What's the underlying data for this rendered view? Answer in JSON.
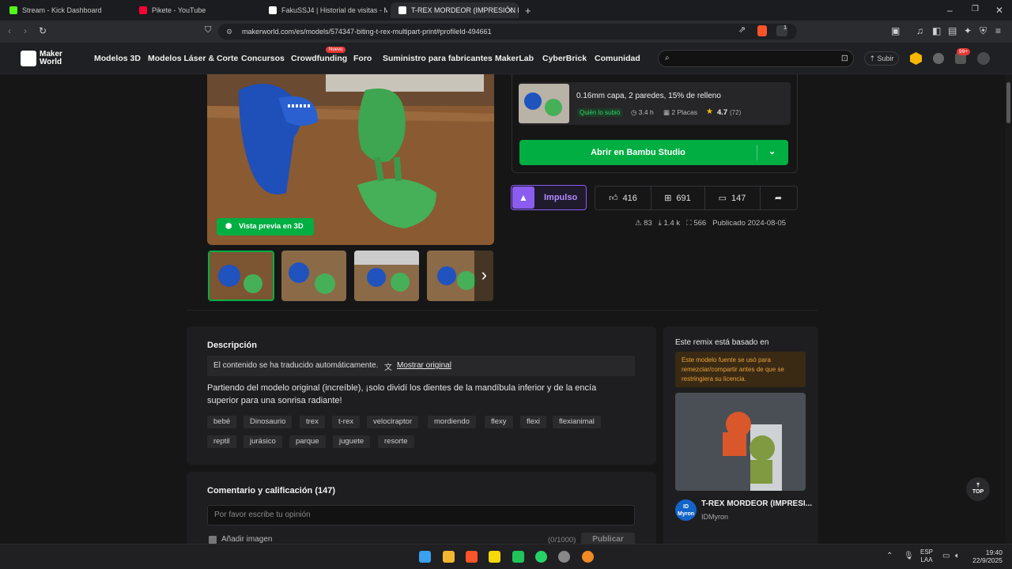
{
  "browser": {
    "tabs": [
      {
        "label": "Stream - Kick Dashboard",
        "color": "#53fc18"
      },
      {
        "label": "Pikete - YouTube",
        "color": "#ff0033"
      },
      {
        "label": "FakuSSJ4 | Historial de visitas - Make",
        "color": "#ffffff"
      },
      {
        "label": "T-REX MORDEOR (IMPRESIÓN E",
        "color": "#ffffff"
      }
    ],
    "url": "makerworld.com/es/models/574347-biting-t-rex-multipart-print#profileId-494661",
    "shield_badge": "1"
  },
  "site": {
    "logo_line1": "Maker",
    "logo_line2": "World",
    "nav": [
      "Modelos 3D",
      "Modelos Láser & Corte",
      "Concursos",
      "Crowdfunding",
      "Foro",
      "Suministro para fabricantes",
      "MakerLab",
      "CyberBrick",
      "Comunidad"
    ],
    "new_badge": "Nuevo",
    "upload_label": "Subir",
    "notif_badge": "99+"
  },
  "gallery": {
    "preview_3d": "Vista previa en 3D"
  },
  "profile": {
    "settings": "0.16mm capa, 2 paredes, 15% de relleno",
    "uploader_badge": "Quién lo subió",
    "time": "3.4 h",
    "plates": "2 Placas",
    "rating": "4.7",
    "rating_count": "(72)",
    "open_button": "Abrir en Bambu Studio"
  },
  "actions": {
    "boost_label": "Impulso",
    "likes": "416",
    "collects": "691",
    "comments": "147"
  },
  "meta": {
    "prints": "83",
    "downloads": "1.4 k",
    "makes": "566",
    "published": "Publicado 2024-08-05"
  },
  "description": {
    "heading": "Descripción",
    "translated_note": "El contenido se ha traducido automáticamente.",
    "show_original": "Mostrar original",
    "text": "Partiendo del modelo original (increíble), ¡solo dividí los dientes de la mandíbula inferior y de la encía superior para una sonrisa radiante!",
    "tags": [
      "bebé",
      "Dinosaurio",
      "trex",
      "t-rex",
      "velociraptor",
      "mordiendo",
      "flexy",
      "flexi",
      "flexianimal",
      "reptil",
      "jurásico",
      "parque",
      "juguete",
      "resorte"
    ]
  },
  "comments": {
    "heading": "Comentario y calificación (147)",
    "placeholder": "Por favor escribe tu opinión",
    "add_image": "Añadir imagen",
    "counter": "(0/1000)",
    "publish": "Publicar"
  },
  "remix": {
    "heading": "Este remix está basado en",
    "note": "Este modelo fuente se usó para remezclar/compartir antes de que se restringiera su licencia.",
    "title": "T-REX MORDEOR (IMPRESI...",
    "author": "IDMyron",
    "avatar_text": "ID Myron"
  },
  "top_button": "TOP",
  "taskbar": {
    "lang1": "ESP",
    "lang2": "LAA",
    "time": "19:40",
    "date": "22/9/2025"
  }
}
